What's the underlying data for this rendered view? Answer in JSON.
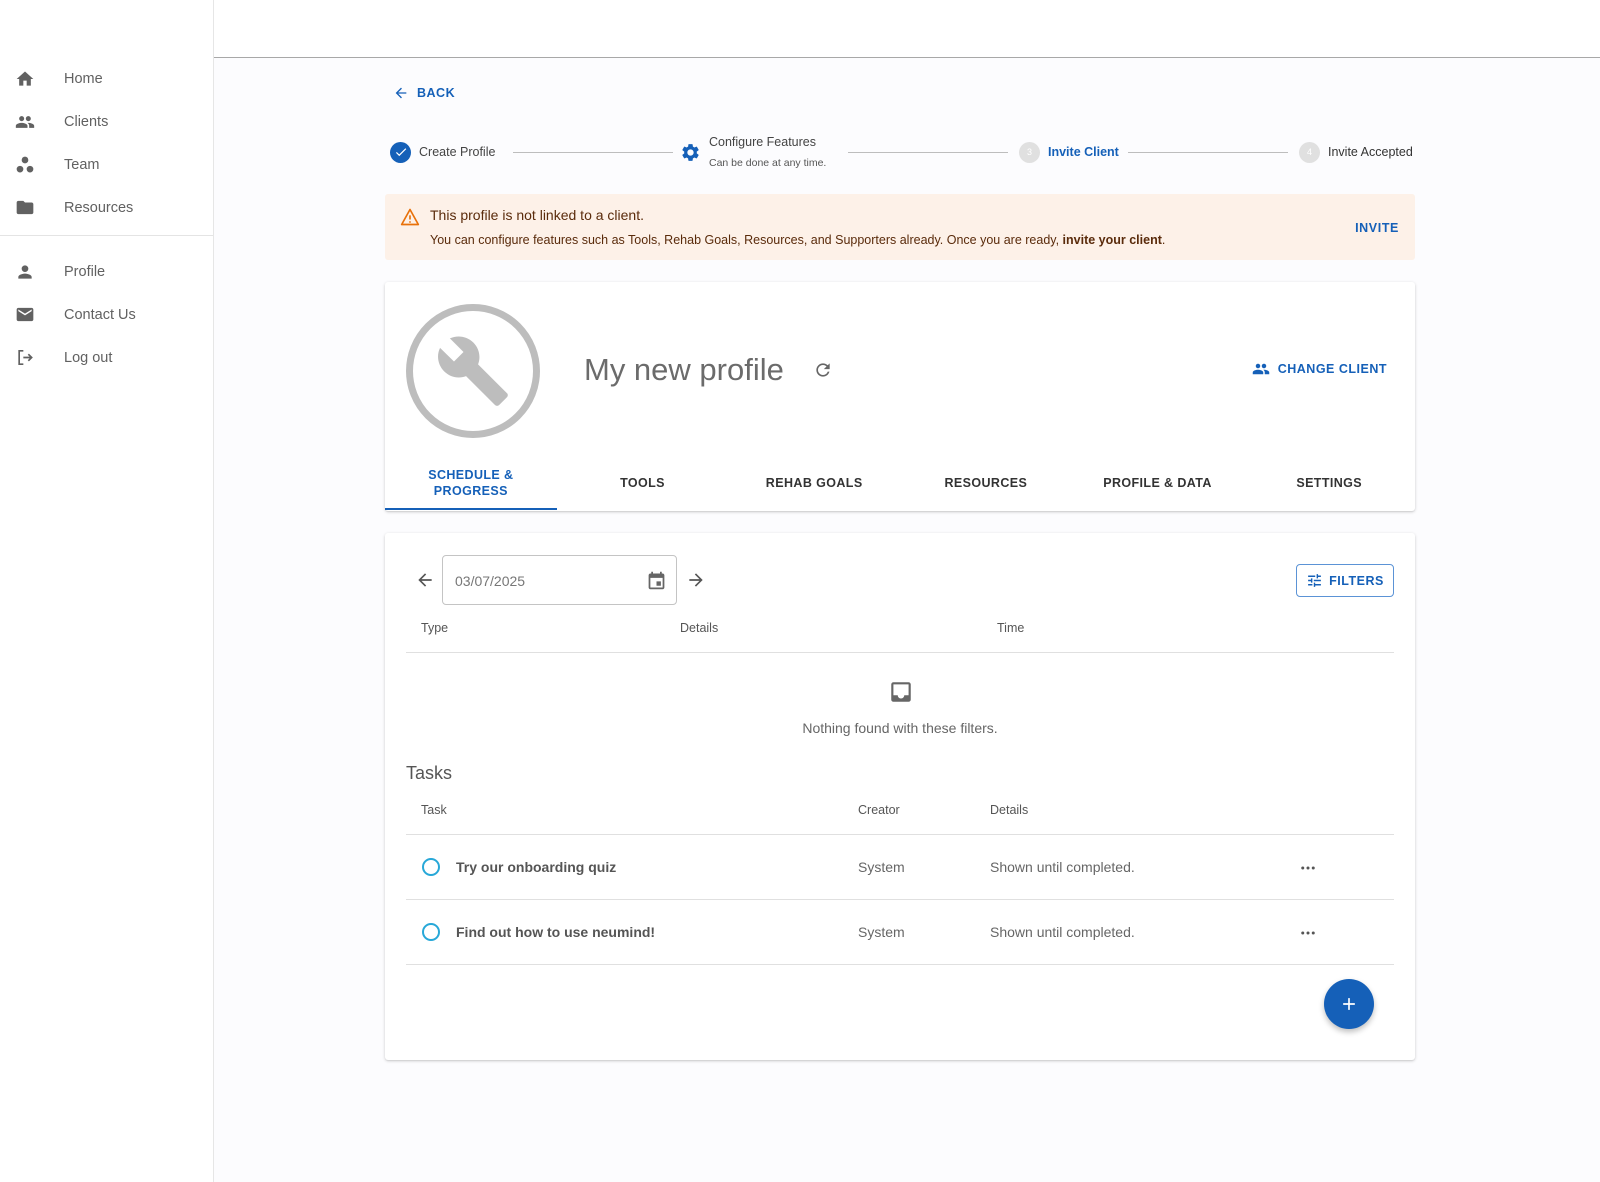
{
  "sidebar": {
    "items": [
      {
        "label": "Home",
        "icon": "home-icon"
      },
      {
        "label": "Clients",
        "icon": "people-icon"
      },
      {
        "label": "Team",
        "icon": "team-icon"
      },
      {
        "label": "Resources",
        "icon": "folder-icon"
      }
    ],
    "account_items": [
      {
        "label": "Profile",
        "icon": "person-icon"
      },
      {
        "label": "Contact Us",
        "icon": "mail-icon"
      },
      {
        "label": "Log out",
        "icon": "logout-icon"
      }
    ]
  },
  "back_label": "BACK",
  "stepper": {
    "steps": [
      {
        "label": "Create Profile",
        "state": "completed"
      },
      {
        "label": "Configure Features",
        "sublabel": "Can be done at any time.",
        "state": "optional"
      },
      {
        "label": "Invite Client",
        "number": "3",
        "state": "active"
      },
      {
        "label": "Invite Accepted",
        "number": "4",
        "state": "pending"
      }
    ]
  },
  "alert": {
    "title": "This profile is not linked to a client.",
    "message": "You can configure features such as Tools, Rehab Goals, Resources, and Supporters already. Once you are ready, ",
    "message_bold": "invite your client",
    "message_end": ".",
    "action": "INVITE"
  },
  "profile": {
    "name": "My new profile",
    "change_client": "CHANGE CLIENT"
  },
  "tabs": [
    {
      "line1": "SCHEDULE &",
      "line2": "PROGRESS",
      "active": true
    },
    {
      "line1": "TOOLS",
      "line2": "",
      "active": false
    },
    {
      "line1": "REHAB GOALS",
      "line2": "",
      "active": false
    },
    {
      "line1": "RESOURCES",
      "line2": "",
      "active": false
    },
    {
      "line1": "PROFILE & DATA",
      "line2": "",
      "active": false
    },
    {
      "line1": "SETTINGS",
      "line2": "",
      "active": false
    }
  ],
  "schedule": {
    "date": "03/07/2025",
    "filters_label": "FILTERS",
    "columns": {
      "type": "Type",
      "details": "Details",
      "time": "Time"
    },
    "empty_text": "Nothing found with these filters."
  },
  "tasks": {
    "title": "Tasks",
    "columns": {
      "task": "Task",
      "creator": "Creator",
      "details": "Details"
    },
    "rows": [
      {
        "name": "Try our onboarding quiz",
        "creator": "System",
        "details": "Shown until completed."
      },
      {
        "name": "Find out how to use neumind!",
        "creator": "System",
        "details": "Shown until completed."
      }
    ]
  },
  "colors": {
    "primary": "#1560b8",
    "warning_bg": "#fdf1e8",
    "warning_icon": "#e8710a",
    "task_radio": "#28a8d8"
  }
}
